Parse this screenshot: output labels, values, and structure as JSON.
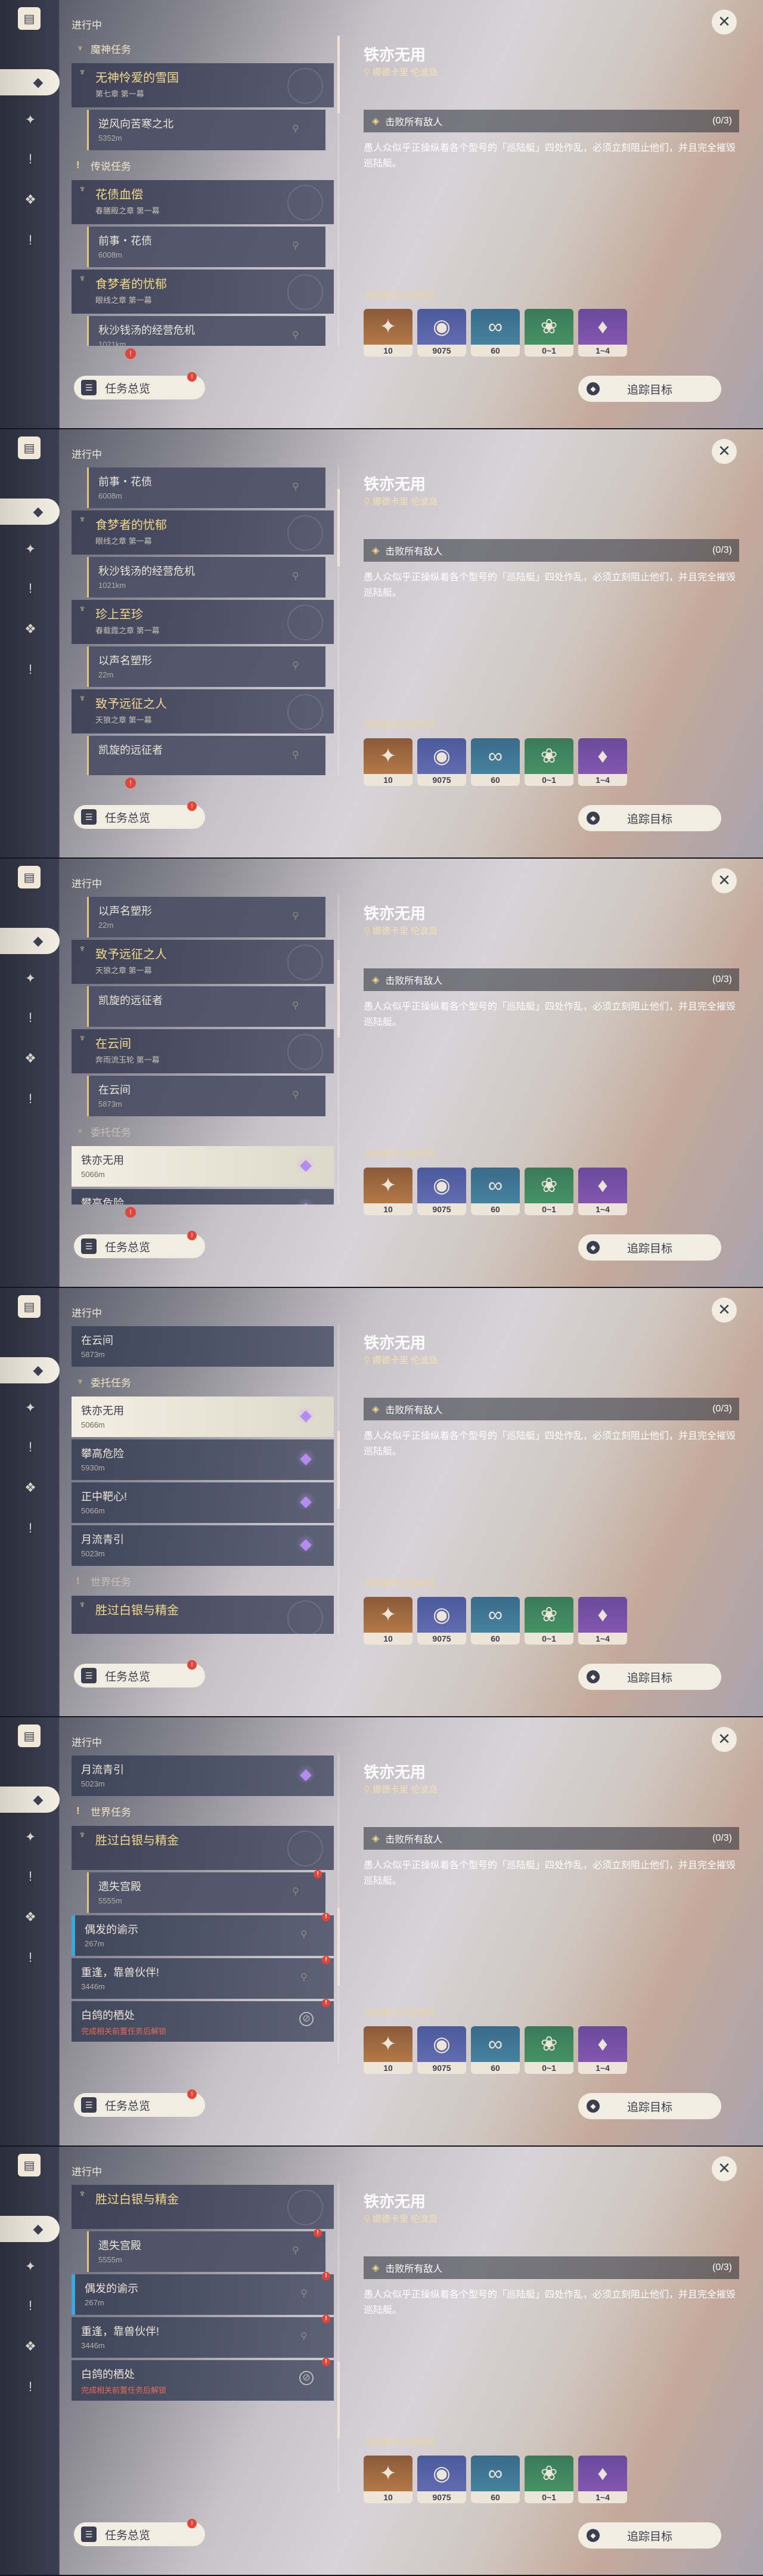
{
  "header": {
    "progress_label": "进行中",
    "overview_label": "任务总览",
    "overview_badge": "!"
  },
  "rail": {
    "book_icon": "book-icon",
    "items": [
      "diamond-icon",
      "compass-icon",
      "exclamation-icon",
      "star-icon",
      "exclamation-icon"
    ]
  },
  "detail": {
    "title": "铁亦无用",
    "location": "娜德卡里 伦波岛",
    "objective": "击败所有敌人",
    "objective_count": "(0/3)",
    "description": "愚人众似乎正操纵着各个型号的「巡陆艇」四处作乱，必须立刻阻止他们，并且完全摧毁巡陆艇。",
    "reward_label": "完成委托以后获得",
    "rewards": [
      {
        "icon": "primogem-icon",
        "count": "10",
        "quality": "q5"
      },
      {
        "icon": "mora-icon",
        "count": "9075",
        "quality": "q4"
      },
      {
        "icon": "companionship-icon",
        "count": "60",
        "quality": "q3"
      },
      {
        "icon": "material-icon",
        "count": "0~1",
        "quality": "q2"
      },
      {
        "icon": "crystal-icon",
        "count": "1~4",
        "quality": "q1"
      }
    ],
    "track_label": "追踪目标",
    "close_icon": "close-icon"
  },
  "frames": [
    {
      "scroll": 0,
      "items": [
        {
          "kind": "cat",
          "icon": "archon-icon",
          "label": "魔神任务"
        },
        {
          "kind": "quest",
          "title": "无神怜爱的雪国",
          "sub": "第七章 第一幕"
        },
        {
          "kind": "sub",
          "title": "逆风向苦寒之北",
          "dist": "5352m",
          "pin": true
        },
        {
          "kind": "cat",
          "icon": "legend-icon",
          "label": "传说任务"
        },
        {
          "kind": "quest",
          "title": "花债血偿",
          "sub": "春膳殿之章 第一幕"
        },
        {
          "kind": "sub",
          "title": "前事・花债",
          "dist": "6008m",
          "pin": true
        },
        {
          "kind": "quest",
          "title": "食梦者的忧郁",
          "sub": "眼线之章 第一幕"
        },
        {
          "kind": "sub",
          "title": "秋沙钱汤的经营危机",
          "dist": "1021km",
          "pin": true
        }
      ]
    },
    {
      "scroll": 40,
      "items": [
        {
          "kind": "sub",
          "title": "前事・花债",
          "dist": "6008m",
          "pin": true
        },
        {
          "kind": "quest",
          "title": "食梦者的忧郁",
          "sub": "眼线之章 第一幕"
        },
        {
          "kind": "sub",
          "title": "秋沙钱汤的经营危机",
          "dist": "1021km",
          "pin": true
        },
        {
          "kind": "quest",
          "title": "珍上至珍",
          "sub": "春载霞之章 第一幕"
        },
        {
          "kind": "sub",
          "title": "以声名塑形",
          "dist": "22m",
          "pin": true
        },
        {
          "kind": "quest",
          "title": "致予远征之人",
          "sub": "天狼之章 第一幕"
        },
        {
          "kind": "sub",
          "title": "凯旋的远征者",
          "dist": "",
          "pin": true
        }
      ]
    },
    {
      "scroll": 90,
      "items": [
        {
          "kind": "sub",
          "title": "以声名塑形",
          "dist": "22m",
          "pin": true
        },
        {
          "kind": "quest",
          "title": "致予远征之人",
          "sub": "天狼之章 第一幕"
        },
        {
          "kind": "sub",
          "title": "凯旋的远征者",
          "dist": "",
          "pin": true
        },
        {
          "kind": "quest",
          "title": "在云间",
          "sub": "奔雨流玉轮 第一幕"
        },
        {
          "kind": "sub",
          "title": "在云间",
          "dist": "5873m",
          "pin": true
        },
        {
          "kind": "cat",
          "icon": "commission-icon",
          "label": "委托任务",
          "faded": true
        },
        {
          "kind": "sub-selected",
          "title": "铁亦无用",
          "dist": "5066m",
          "diamond": true
        },
        {
          "kind": "sub-diamond",
          "title": "攀高危险",
          "dist": "5930m"
        }
      ]
    },
    {
      "scroll": 150,
      "items": [
        {
          "kind": "sub-plain",
          "title": "在云间",
          "dist": "5873m"
        },
        {
          "kind": "cat",
          "icon": "commission-icon",
          "label": "委托任务"
        },
        {
          "kind": "sub-selected",
          "title": "铁亦无用",
          "dist": "5066m",
          "diamond": true
        },
        {
          "kind": "sub-diamond",
          "title": "攀高危险",
          "dist": "5930m"
        },
        {
          "kind": "sub-diamond",
          "title": "正中靶心!",
          "dist": "5066m"
        },
        {
          "kind": "sub-diamond",
          "title": "月流青引",
          "dist": "5023m"
        },
        {
          "kind": "cat",
          "icon": "world-icon",
          "label": "世界任务",
          "faded": true
        },
        {
          "kind": "quest",
          "title": "胜过白银与精金",
          "sub": ""
        }
      ]
    },
    {
      "scroll": 220,
      "items": [
        {
          "kind": "sub-diamond",
          "title": "月流青引",
          "dist": "5023m"
        },
        {
          "kind": "cat",
          "icon": "world-icon",
          "label": "世界任务"
        },
        {
          "kind": "quest",
          "title": "胜过白银与精金",
          "sub": ""
        },
        {
          "kind": "sub",
          "title": "遗失宫殿",
          "dist": "5555m",
          "pin": true,
          "badge": true
        },
        {
          "kind": "sub-blue",
          "title": "偶发的谕示",
          "dist": "267m",
          "pin": true,
          "badge": true
        },
        {
          "kind": "sub-plain",
          "title": "重逢，靠兽伙伴!",
          "dist": "3446m",
          "pin": true,
          "badge": true
        },
        {
          "kind": "sub-plain",
          "title": "白鸽的栖处",
          "dist": "完成相关前置任务后解锁",
          "red": true,
          "lock": true,
          "badge": true
        }
      ]
    },
    {
      "scroll": 260,
      "items": [
        {
          "kind": "quest",
          "title": "胜过白银与精金",
          "sub": ""
        },
        {
          "kind": "sub",
          "title": "遗失宫殿",
          "dist": "5555m",
          "pin": true,
          "badge": true
        },
        {
          "kind": "sub-blue",
          "title": "偶发的谕示",
          "dist": "267m",
          "pin": true,
          "badge": true
        },
        {
          "kind": "sub-plain",
          "title": "重逢，靠兽伙伴!",
          "dist": "3446m",
          "pin": true,
          "badge": true
        },
        {
          "kind": "sub-plain",
          "title": "白鸽的栖处",
          "dist": "完成相关前置任务后解锁",
          "red": true,
          "lock": true,
          "badge": true
        }
      ]
    }
  ]
}
